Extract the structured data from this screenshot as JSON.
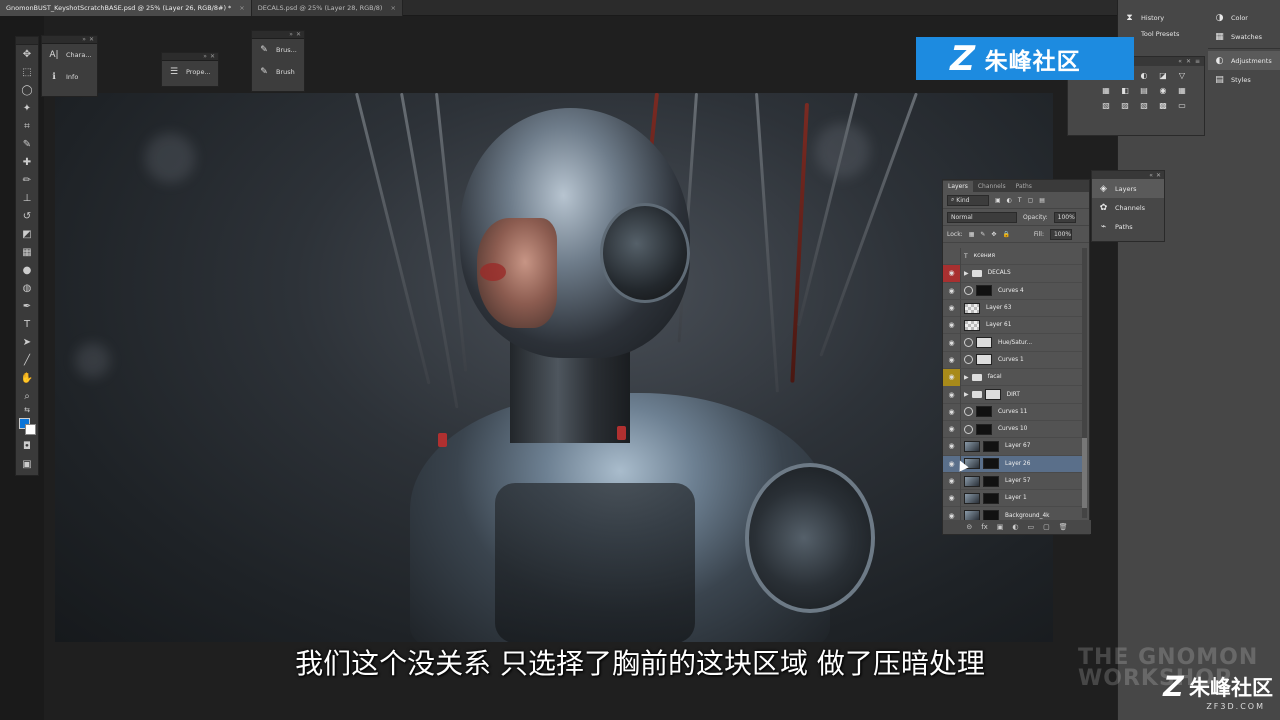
{
  "tabs": [
    {
      "label": "GnomonBUST_KeyshotScratchBASE.psd @ 25% (Layer 26, RGB/8#) *",
      "close": "×"
    },
    {
      "label": "DECALS.psd @ 25% (Layer 28, RGB/8)",
      "close": "×"
    }
  ],
  "mini_panels": {
    "panel1": [
      {
        "icon": "A|",
        "label": "Chara..."
      },
      {
        "icon": "ℹ",
        "label": "Info"
      }
    ],
    "panel2": [
      {
        "icon": "☰",
        "label": "Prope..."
      }
    ],
    "panel3": [
      {
        "icon": "✎",
        "label": "Brus..."
      },
      {
        "icon": "✎",
        "label": "Brush"
      }
    ]
  },
  "dock": {
    "col1": [
      "History",
      "Tool Presets"
    ],
    "col2": [
      "Color",
      "Swatches",
      "Adjustments",
      "Styles"
    ]
  },
  "adjustments": {
    "icons": [
      "☀",
      "▥",
      "◐",
      "◪",
      "▽",
      "▦",
      "◧",
      "▤",
      "◉",
      "▦",
      "▧",
      "▨",
      "▧",
      "▩",
      "▭"
    ]
  },
  "layers": {
    "tabs": [
      "Layers",
      "Channels",
      "Paths"
    ],
    "filter": "Kind",
    "blend": "Normal",
    "opacity_label": "Opacity:",
    "opacity": "100%",
    "lock_label": "Lock:",
    "fill_label": "Fill:",
    "fill": "100%",
    "rows": [
      {
        "name": "ксения",
        "eye": "",
        "kind": "text"
      },
      {
        "name": "DECALS",
        "eye": "red",
        "kind": "folder"
      },
      {
        "name": "Curves 4",
        "eye": "",
        "kind": "adj"
      },
      {
        "name": "Layer 63",
        "eye": "",
        "kind": "check"
      },
      {
        "name": "Layer 61",
        "eye": "",
        "kind": "check"
      },
      {
        "name": "Hue/Satur...",
        "eye": "",
        "kind": "adj-white"
      },
      {
        "name": "Curves 1",
        "eye": "",
        "kind": "adj-white"
      },
      {
        "name": "facal",
        "eye": "yellow",
        "kind": "folder"
      },
      {
        "name": "DIRT",
        "eye": "",
        "kind": "folder-mask"
      },
      {
        "name": "Curves 11",
        "eye": "",
        "kind": "adj"
      },
      {
        "name": "Curves 10",
        "eye": "",
        "kind": "adj"
      },
      {
        "name": "Layer 67",
        "eye": "",
        "kind": "img"
      },
      {
        "name": "Layer 26",
        "eye": "",
        "kind": "img",
        "selected": true
      },
      {
        "name": "Layer 57",
        "eye": "",
        "kind": "img"
      },
      {
        "name": "Layer 1",
        "eye": "",
        "kind": "img"
      },
      {
        "name": "Background_4k",
        "eye": "",
        "kind": "img"
      }
    ],
    "footer": [
      "⊝",
      "fx",
      "▣",
      "◐",
      "▭",
      "▢",
      "🗑"
    ]
  },
  "collapsed_panel": [
    "Layers",
    "Channels",
    "Paths"
  ],
  "watermark": {
    "logo": "Z",
    "text": "朱峰社区",
    "site": "ZF3D.COM"
  },
  "gnomon": {
    "line1": "THE GNOMON",
    "line2": "WORKSHOP"
  },
  "subtitle": "我们这个没关系 只选择了胸前的这块区域 做了压暗处理"
}
